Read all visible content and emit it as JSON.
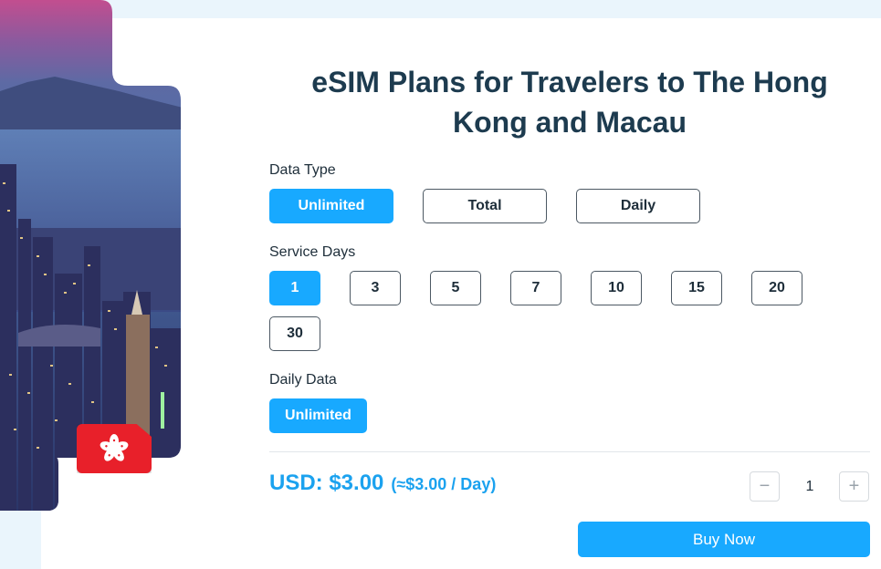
{
  "title": "eSIM Plans for Travelers to The Hong Kong and Macau",
  "flag": {
    "name": "hong-kong-flag",
    "color": "#e8202a"
  },
  "data_type": {
    "label": "Data Type",
    "options": [
      "Unlimited",
      "Total",
      "Daily"
    ],
    "selected": "Unlimited"
  },
  "service_days": {
    "label": "Service Days",
    "options": [
      "1",
      "3",
      "5",
      "7",
      "10",
      "15",
      "20",
      "30"
    ],
    "selected": "1"
  },
  "daily_data": {
    "label": "Daily Data",
    "options": [
      "Unlimited"
    ],
    "selected": "Unlimited"
  },
  "price": {
    "main": "USD: $3.00",
    "per_day": "(≈$3.00 / Day)"
  },
  "quantity": {
    "value": "1",
    "minus": "−",
    "plus": "+"
  },
  "buy_label": "Buy Now",
  "colors": {
    "accent": "#18a9ff",
    "title": "#1d3b4f",
    "price": "#1ba2ef"
  }
}
